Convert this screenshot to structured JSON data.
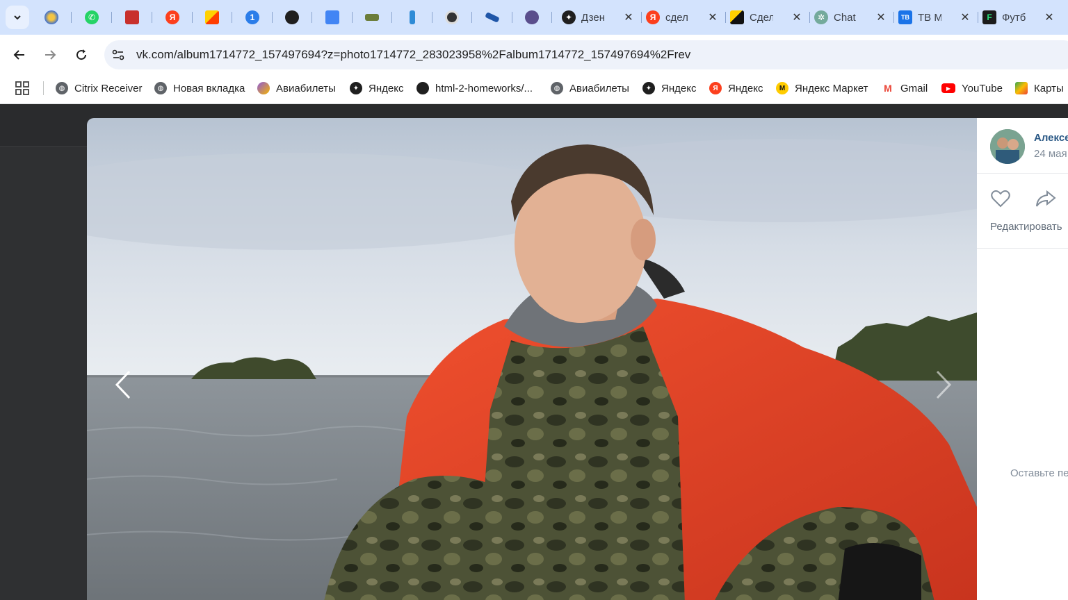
{
  "tabs": {
    "active_tab_count": 6,
    "open_tabs": [
      {
        "title": "Дзен",
        "icon": "dzen-icon"
      },
      {
        "title": "сдел",
        "icon": "yandex-icon"
      },
      {
        "title": "Сдел",
        "icon": "generic-site-icon"
      },
      {
        "title": "Chat",
        "icon": "chatgpt-icon"
      },
      {
        "title": "ТВ М",
        "icon": "tv-icon"
      },
      {
        "title": "Футб",
        "icon": "football-icon"
      }
    ]
  },
  "toolbar": {
    "url": "vk.com/album1714772_157497694?z=photo1714772_283023958%2Falbum1714772_157497694%2Frev"
  },
  "bookmarks": [
    {
      "label": "Citrix Receiver",
      "icon": "globe-icon"
    },
    {
      "label": "Новая вкладка",
      "icon": "globe-icon"
    },
    {
      "label": "Авиабилеты",
      "icon": "aviasales-icon"
    },
    {
      "label": "Яндекс",
      "icon": "dzen-icon"
    },
    {
      "label": "html-2-homeworks/...",
      "icon": "github-icon"
    },
    {
      "label": "Авиабилеты",
      "icon": "globe-icon"
    },
    {
      "label": "Яндекс",
      "icon": "dzen-icon"
    },
    {
      "label": "Яндекс",
      "icon": "yandex-icon"
    },
    {
      "label": "Яндекс Маркет",
      "icon": "market-icon"
    },
    {
      "label": "Gmail",
      "icon": "gmail-icon"
    },
    {
      "label": "YouTube",
      "icon": "youtube-icon"
    },
    {
      "label": "Карты",
      "icon": "maps-icon"
    }
  ],
  "photo_panel": {
    "author": "Алексей",
    "date": "24 мая",
    "edit_label": "Редактировать",
    "comment_hint": "Оставьте первый комментарий"
  },
  "colors": {
    "tab_strip": "#d3e3fd",
    "jacket": "#e8412a",
    "vk_link": "#2a5885"
  }
}
